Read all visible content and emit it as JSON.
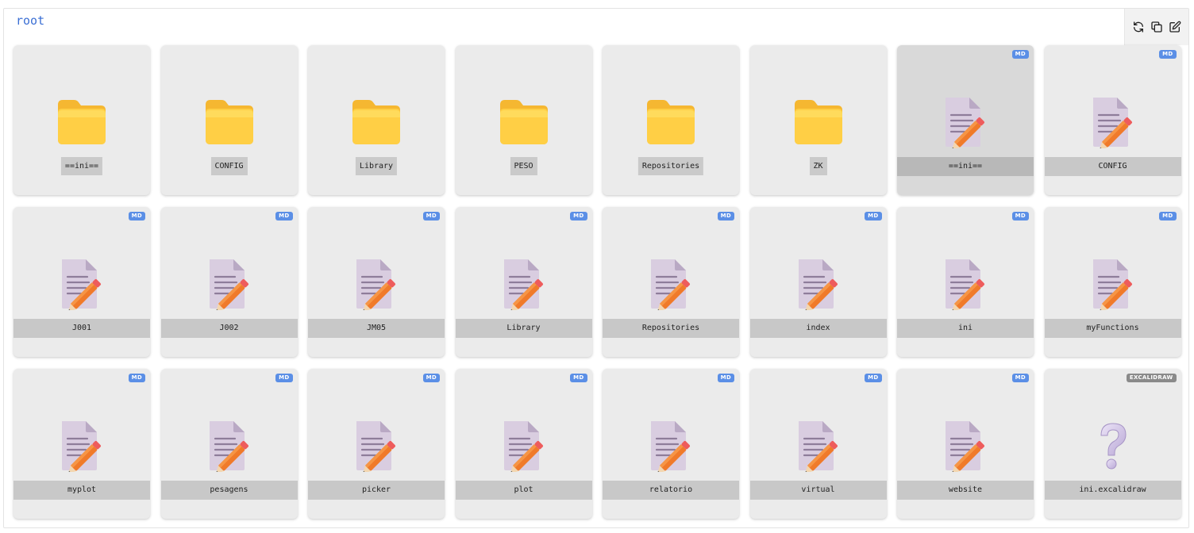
{
  "breadcrumb": "root",
  "toolbar": {
    "buttons": [
      {
        "name": "refresh-button",
        "icon": "refresh-icon"
      },
      {
        "name": "copy-button",
        "icon": "copy-icon"
      },
      {
        "name": "edit-button",
        "icon": "edit-icon"
      }
    ]
  },
  "colors": {
    "accent": "#3b6fd4",
    "badge_md": "#5b8fe6",
    "badge_excalidraw": "#8a8a8a",
    "folder": "#ffc93c"
  },
  "items": [
    {
      "kind": "folder",
      "label": "==ini=="
    },
    {
      "kind": "folder",
      "label": "CONFIG"
    },
    {
      "kind": "folder",
      "label": "Library"
    },
    {
      "kind": "folder",
      "label": "PESO"
    },
    {
      "kind": "folder",
      "label": "Repositories"
    },
    {
      "kind": "folder",
      "label": "ZK"
    },
    {
      "kind": "file",
      "label": "==ini==",
      "badge": "MD",
      "selected": true
    },
    {
      "kind": "file",
      "label": "CONFIG",
      "badge": "MD"
    },
    {
      "kind": "file",
      "label": "J001",
      "badge": "MD"
    },
    {
      "kind": "file",
      "label": "J002",
      "badge": "MD"
    },
    {
      "kind": "file",
      "label": "JM05",
      "badge": "MD"
    },
    {
      "kind": "file",
      "label": "Library",
      "badge": "MD"
    },
    {
      "kind": "file",
      "label": "Repositories",
      "badge": "MD"
    },
    {
      "kind": "file",
      "label": "index",
      "badge": "MD"
    },
    {
      "kind": "file",
      "label": "ini",
      "badge": "MD"
    },
    {
      "kind": "file",
      "label": "myFunctions",
      "badge": "MD"
    },
    {
      "kind": "file",
      "label": "myplot",
      "badge": "MD"
    },
    {
      "kind": "file",
      "label": "pesagens",
      "badge": "MD"
    },
    {
      "kind": "file",
      "label": "picker",
      "badge": "MD"
    },
    {
      "kind": "file",
      "label": "plot",
      "badge": "MD"
    },
    {
      "kind": "file",
      "label": "relatorio",
      "badge": "MD"
    },
    {
      "kind": "file",
      "label": "virtual",
      "badge": "MD"
    },
    {
      "kind": "file",
      "label": "website",
      "badge": "MD"
    },
    {
      "kind": "unknown",
      "label": "ini.excalidraw",
      "badge": "EXCALIDRAW"
    }
  ]
}
